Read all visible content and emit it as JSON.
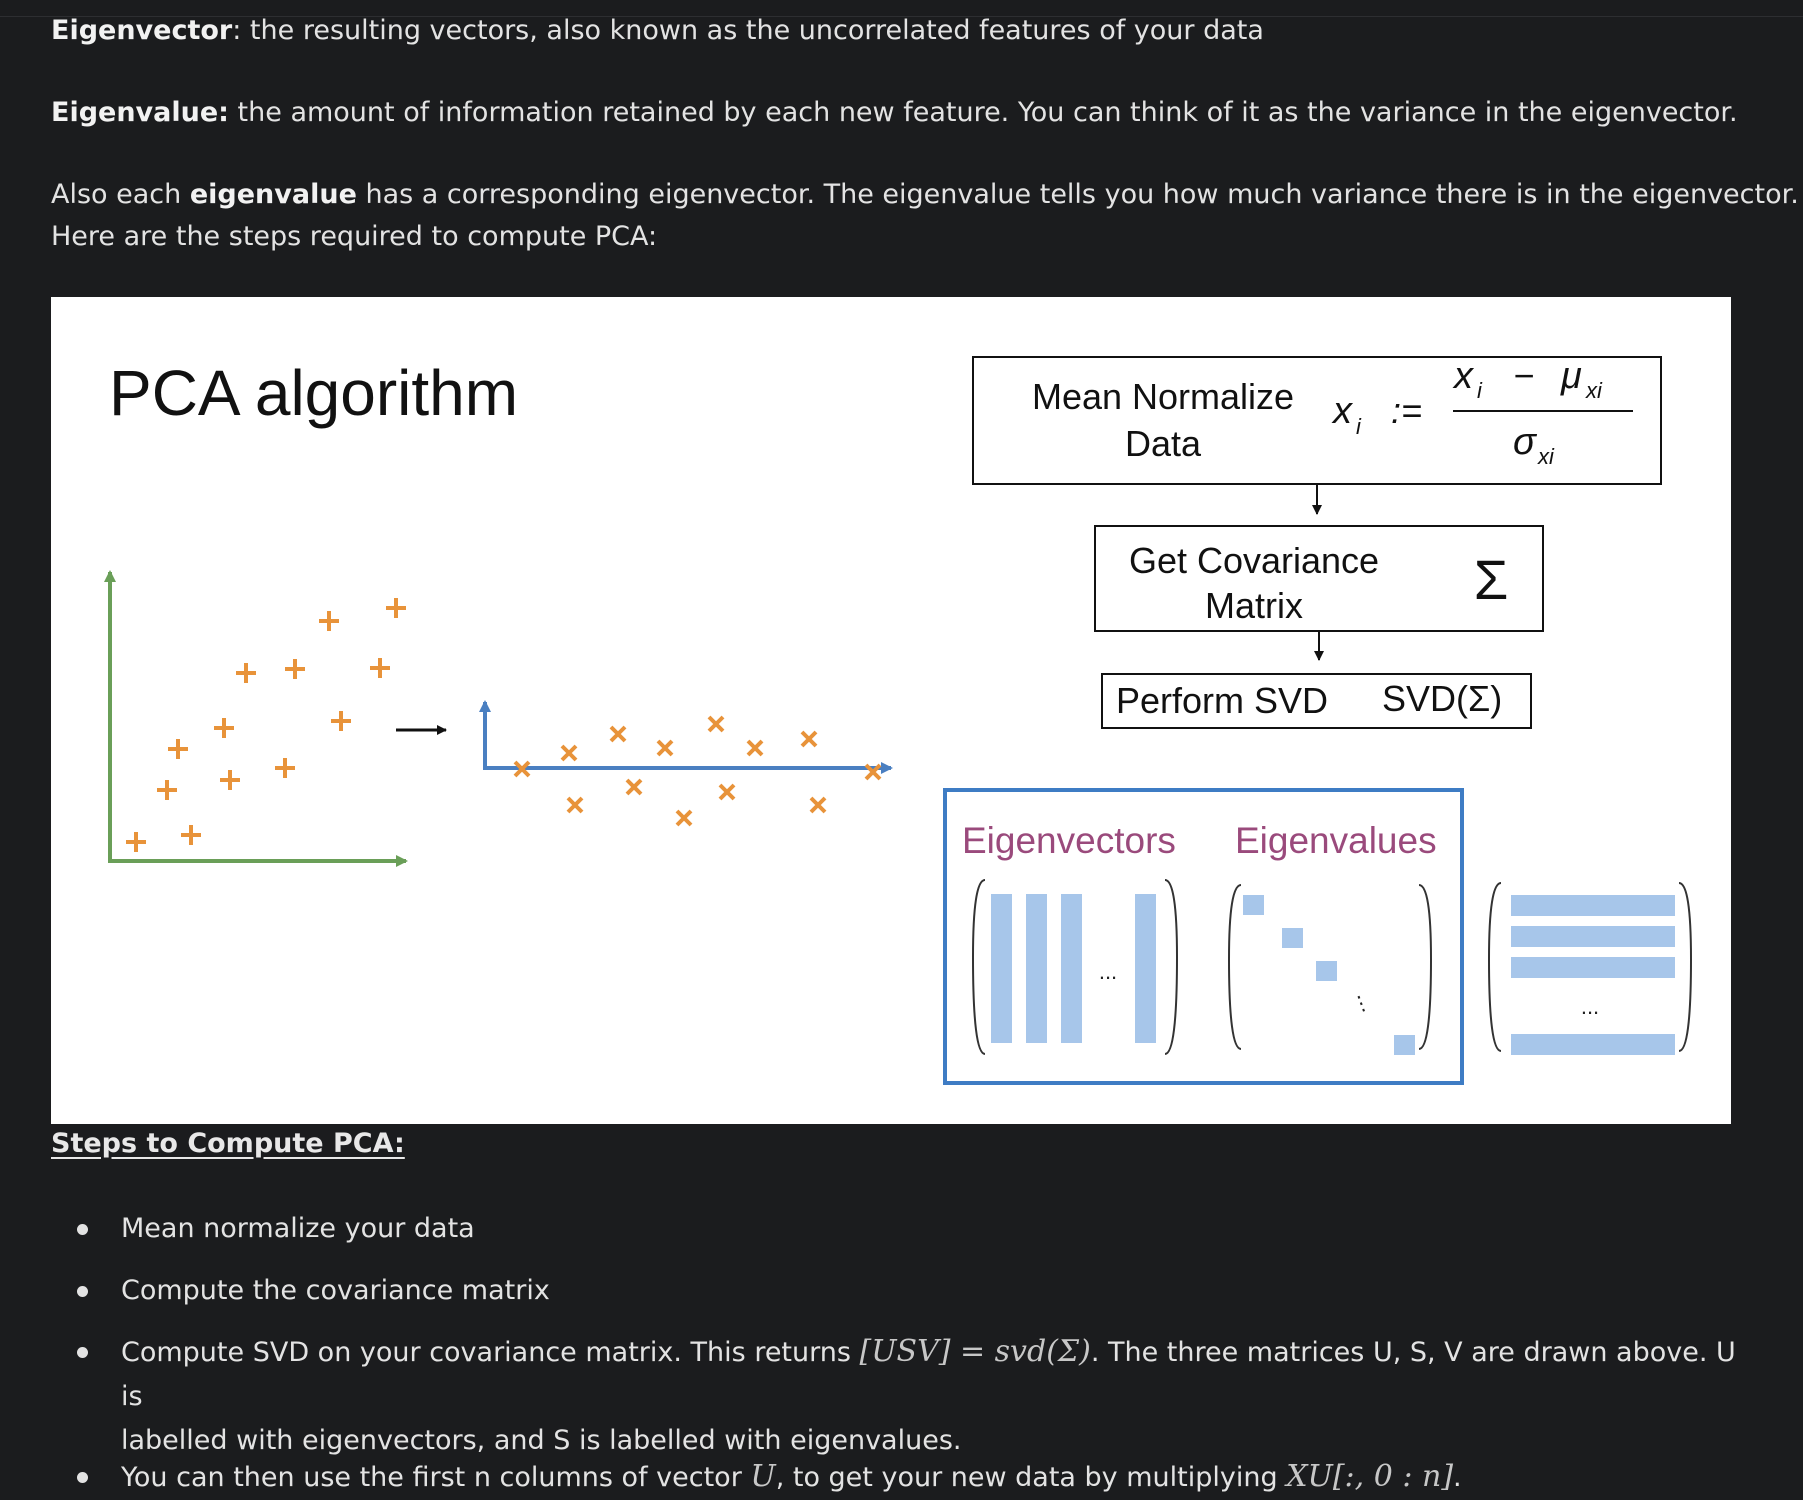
{
  "intro": {
    "eigenvector_term": "Eigenvector",
    "eigenvector_text": ": the resulting vectors, also known as the uncorrelated features of your data",
    "eigenvalue_term": "Eigenvalue:",
    "eigenvalue_text": " the amount of information retained by each new feature. You can think of it as the variance in the eigenvector.",
    "also_prefix": "Also each ",
    "also_bold": "eigenvalue",
    "also_suffix": " has a corresponding eigenvector. The eigenvalue tells you how much variance there is in the eigenvector.",
    "steps_intro": "Here are the steps required to compute PCA:"
  },
  "figure": {
    "title": "PCA algorithm",
    "box_mean_line1": "Mean Normalize",
    "box_mean_line2": "Data",
    "formula_lhs": "x",
    "formula_lhs_sub": "i",
    "formula_eq": ":=",
    "formula_num": "x",
    "formula_num_sub": "i",
    "formula_minus": "−",
    "formula_mu": "μ",
    "formula_mu_sub": "xi",
    "formula_sigma": "σ",
    "formula_sigma_sub": "xi",
    "box_cov_line1": "Get Covariance",
    "box_cov_line2": "Matrix",
    "cov_symbol": "Σ",
    "box_svd_label": "Perform SVD",
    "svd_formula": "SVD(Σ)",
    "eigenvectors_label": "Eigenvectors",
    "eigenvalues_label": "Eigenvalues",
    "dots_h": "...",
    "dots_v": "⋮",
    "colors": {
      "green_axis": "#6a9f58",
      "blue_axis": "#4a7fc1",
      "orange_marker": "#e8933a",
      "matrix_fill": "#a7c6ea",
      "label_purple": "#9a4a7c",
      "frame_blue": "#3e7cc4"
    }
  },
  "steps": {
    "heading": "Steps to Compute PCA:",
    "items": [
      {
        "text": "Mean normalize your data"
      },
      {
        "text": "Compute the covariance matrix"
      },
      {
        "text_a": "Compute SVD on your covariance matrix. This returns ",
        "math_a": "[USV] = svd(Σ)",
        "text_b": ". The three matrices U, S, V are drawn above. U is",
        "text_c": "labelled with eigenvectors, and S is labelled with eigenvalues."
      },
      {
        "text_a": "You can then use the first n columns of vector ",
        "math_a": "U",
        "text_b": ", to get your new data by multiplying ",
        "math_b": "XU[:, 0 : n]",
        "text_c": "."
      }
    ]
  }
}
